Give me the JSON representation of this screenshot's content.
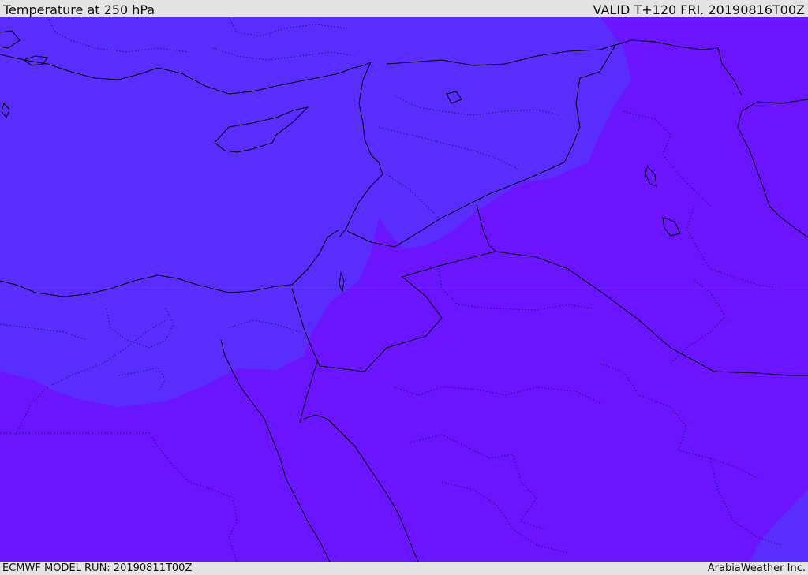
{
  "header": {
    "title": "Temperature at 250 hPa",
    "valid": "VALID T+120 FRI. 20190816T00Z"
  },
  "footer": {
    "model_run": "ECMWF MODEL RUN: 20190811T00Z",
    "credit": "ArabiaWeather Inc."
  },
  "map": {
    "field": "temperature",
    "level": "250 hPa",
    "colors": {
      "field_cooler": "#5a2dff",
      "field_warmer": "#6a14ff",
      "coastline": "#000000",
      "border": "#000000",
      "province_border": "#1a1a66"
    }
  }
}
